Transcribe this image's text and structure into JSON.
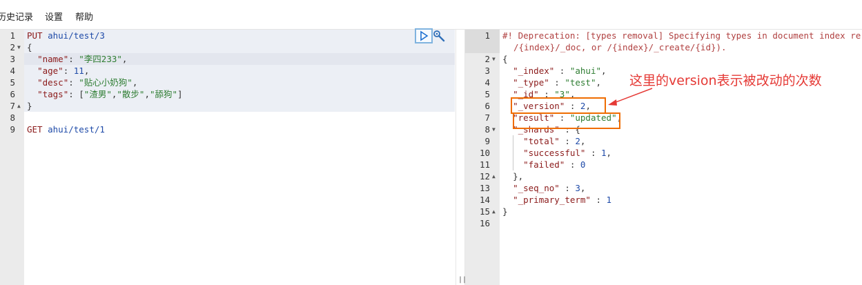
{
  "menu": {
    "items": [
      "历史记录",
      "设置",
      "帮助"
    ]
  },
  "request": {
    "line_numbers": [
      "1",
      "2",
      "3",
      "4",
      "5",
      "6",
      "7",
      "8",
      "9"
    ],
    "lines": {
      "l1_method": "PUT",
      "l1_url": "ahui/test/3",
      "l2": "{",
      "l3_key": "\"name\"",
      "l3_val": "\"李四233\"",
      "l4_key": "\"age\"",
      "l4_val": "11",
      "l5_key": "\"desc\"",
      "l5_val": "\"贴心小奶狗\"",
      "l6_key": "\"tags\"",
      "l6_v1": "\"渣男\"",
      "l6_v2": "\"散步\"",
      "l6_v3": "\"舔狗\"",
      "l7": "}",
      "l9_method": "GET",
      "l9_url": "ahui/test/1"
    },
    "run_icon": "play-icon",
    "wrench_icon": "wrench-icon"
  },
  "response": {
    "line_numbers": [
      "1",
      "",
      "2",
      "3",
      "4",
      "5",
      "6",
      "7",
      "8",
      "9",
      "10",
      "11",
      "12",
      "13",
      "14",
      "15",
      "16"
    ],
    "warning_line1": "#! Deprecation: [types removal] Specifying types in document index re",
    "warning_line2": "/{index}/_doc, or /{index}/_create/{id}).",
    "open_brace": "{",
    "index_key": "\"_index\"",
    "index_val": "\"ahui\"",
    "type_key": "\"_type\"",
    "type_val": "\"test\"",
    "id_key": "\"_id\"",
    "id_val": "\"3\"",
    "version_key": "\"_version\"",
    "version_val": "2",
    "result_key": "\"result\"",
    "result_val": "\"updated\"",
    "shards_key": "\"_shards\"",
    "total_key": "\"total\"",
    "total_val": "2",
    "successful_key": "\"successful\"",
    "successful_val": "1",
    "failed_key": "\"failed\"",
    "failed_val": "0",
    "shards_close": "},",
    "seq_key": "\"_seq_no\"",
    "seq_val": "3",
    "term_key": "\"_primary_term\"",
    "term_val": "1",
    "close_brace": "}"
  },
  "annotation": {
    "text": "这里的version表示被改动的次数",
    "color": "#e53935",
    "box_color": "#ef6c00"
  }
}
